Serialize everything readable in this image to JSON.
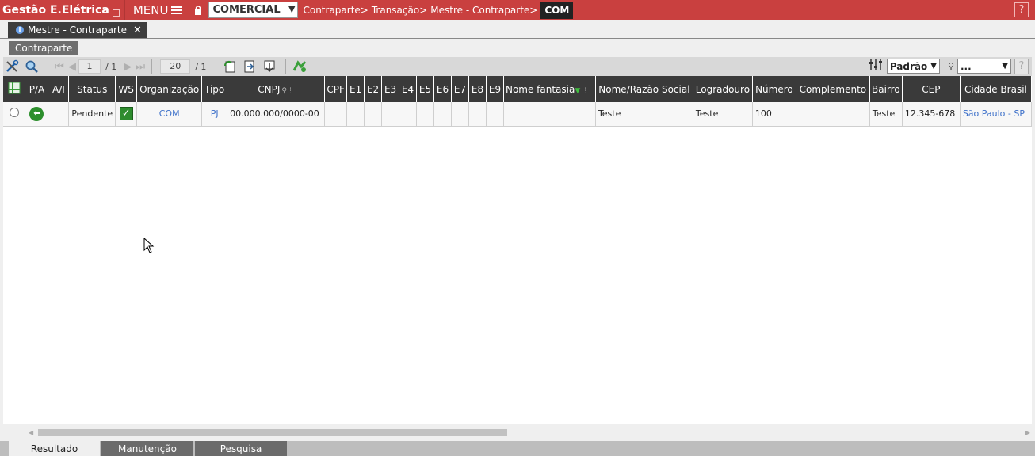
{
  "header": {
    "app_title": "Gestão E.Elétrica",
    "menu_label": "MENU",
    "org_select_value": "COMERCIAL",
    "breadcrumbs": [
      "Contraparte>",
      "Transação>",
      "Mestre - Contraparte>"
    ],
    "breadcrumb_current": "COM",
    "help_label": "?"
  },
  "window_tab": {
    "label": "Mestre - Contraparte",
    "close": "✕"
  },
  "sub_tab": {
    "label": "Contraparte"
  },
  "toolbar": {
    "page_value": "1",
    "page_total": "/ 1",
    "rows_value": "20",
    "rows_total": "/ 1",
    "layout_select": "Padrão",
    "filter_select": "...",
    "help_label": "?"
  },
  "grid": {
    "columns": [
      "",
      "P/A",
      "A/I",
      "Status",
      "WS",
      "Organização",
      "Tipo",
      "CNPJ",
      "CPF",
      "E1",
      "E2",
      "E3",
      "E4",
      "E5",
      "E6",
      "E7",
      "E8",
      "E9",
      "Nome fantasia",
      "Nome/Razão Social",
      "Logradouro",
      "Número",
      "Complemento",
      "Bairro",
      "CEP",
      "Cidade Brasil"
    ],
    "rows": [
      {
        "status": "Pendente",
        "organizacao": "COM",
        "tipo": "PJ",
        "cnpj": "00.000.000/0000-00",
        "cpf": "",
        "nome_fantasia": "",
        "razao_social": "Teste",
        "logradouro": "Teste",
        "numero": "100",
        "complemento": "",
        "bairro": "Teste",
        "cep": "12.345-678",
        "cidade": "São Paulo - SP"
      }
    ]
  },
  "bottom_tabs": [
    "Resultado",
    "Manutenção",
    "Pesquisa"
  ],
  "colors": {
    "header_bar": "#c9403f",
    "grid_header": "#3a3a3a",
    "link": "#3b6fc9"
  }
}
